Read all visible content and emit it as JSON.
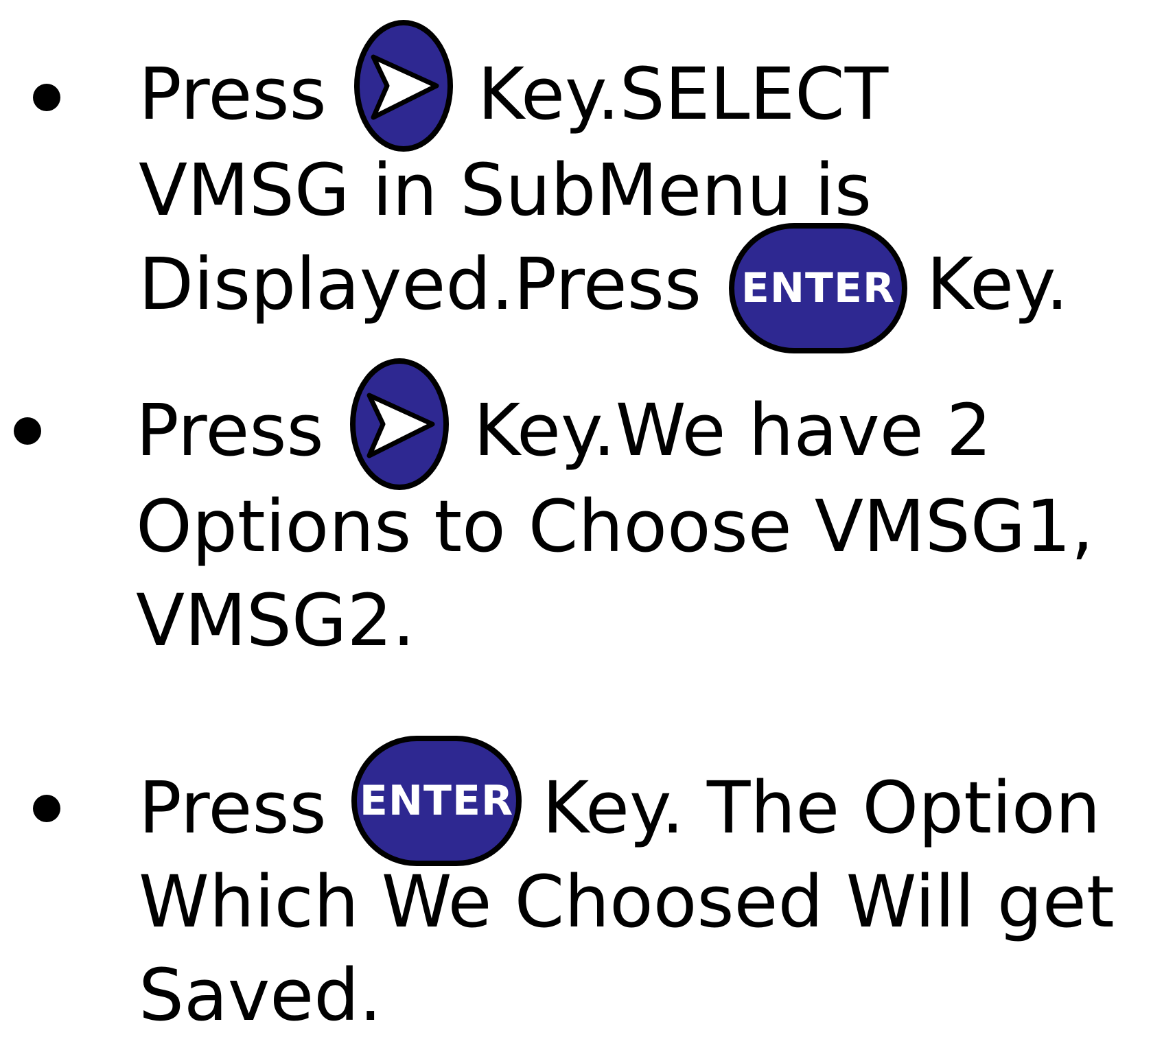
{
  "steps": [
    {
      "line1_pre": "Press",
      "line1_key": "right-arrow-key",
      "line1_post": "Key.SELECT",
      "line2": "VMSG in SubMenu  is",
      "line3_pre": "Displayed.Press",
      "line3_key_label": "ENTER",
      "line3_post": "Key."
    },
    {
      "line1_pre": "Press",
      "line1_key": "right-arrow-key",
      "line1_post": "Key.We have 2",
      "line2": "Options to Choose VMSG1,",
      "line3": "VMSG2."
    },
    {
      "line1_pre": "Press",
      "line1_key_label": "ENTER",
      "line1_post": "Key. The Option",
      "line2": "Which We Choosed Will get",
      "line3": "Saved."
    }
  ],
  "colors": {
    "key_fill": "#2e2891",
    "key_outline": "#000000",
    "text": "#000000"
  }
}
